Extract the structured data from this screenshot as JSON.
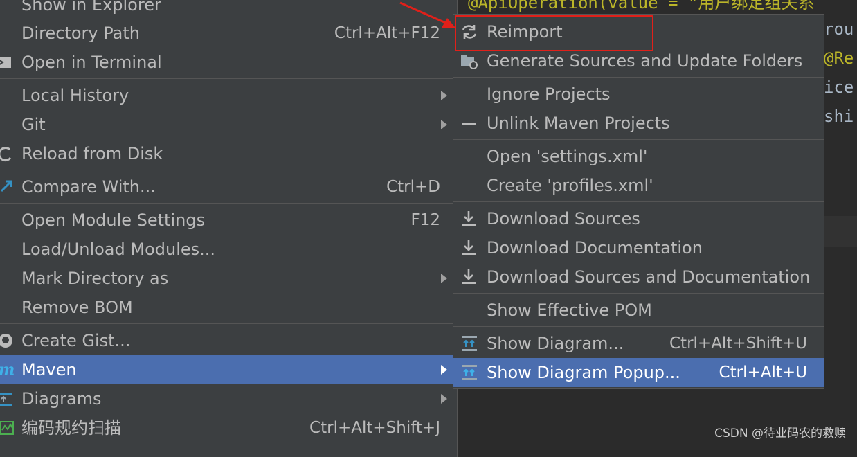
{
  "editor": {
    "line1": "@ApiOperation(value = \"用户绑定组关系",
    "line2": "rou",
    "line3": "@Re",
    "line4": "ice",
    "line5": "shi"
  },
  "main_menu": {
    "items": [
      {
        "label": "Show in Explorer"
      },
      {
        "label": "Directory Path",
        "shortcut": "Ctrl+Alt+F12"
      },
      {
        "label": "Open in Terminal"
      },
      {
        "label": "Local History"
      },
      {
        "label": "Git"
      },
      {
        "label": "Reload from Disk"
      },
      {
        "label": "Compare With...",
        "shortcut": "Ctrl+D"
      },
      {
        "label": "Open Module Settings",
        "shortcut": "F12"
      },
      {
        "label": "Load/Unload Modules..."
      },
      {
        "label": "Mark Directory as"
      },
      {
        "label": "Remove BOM"
      },
      {
        "label": "Create Gist..."
      },
      {
        "label": "Maven"
      },
      {
        "label": "Diagrams"
      },
      {
        "label": "编码规约扫描",
        "shortcut": "Ctrl+Alt+Shift+J"
      }
    ]
  },
  "sub_menu": {
    "items": [
      {
        "label": "Reimport"
      },
      {
        "label": "Generate Sources and Update Folders"
      },
      {
        "label": "Ignore Projects"
      },
      {
        "label": "Unlink Maven Projects"
      },
      {
        "label": "Open 'settings.xml'"
      },
      {
        "label": "Create 'profiles.xml'"
      },
      {
        "label": "Download Sources"
      },
      {
        "label": "Download Documentation"
      },
      {
        "label": "Download Sources and Documentation"
      },
      {
        "label": "Show Effective POM"
      },
      {
        "label": "Show Diagram...",
        "shortcut": "Ctrl+Alt+Shift+U"
      },
      {
        "label": "Show Diagram Popup...",
        "shortcut": "Ctrl+Alt+U"
      }
    ]
  },
  "watermark": "CSDN @待业码农的救赎",
  "colors": {
    "menu_bg": "#3c3f41",
    "selection": "#4b6eaf",
    "editor_bg": "#2b2b2b",
    "annotation": "#e0201a",
    "annotation_code": "#bbb529",
    "string_code": "#6a8759"
  }
}
